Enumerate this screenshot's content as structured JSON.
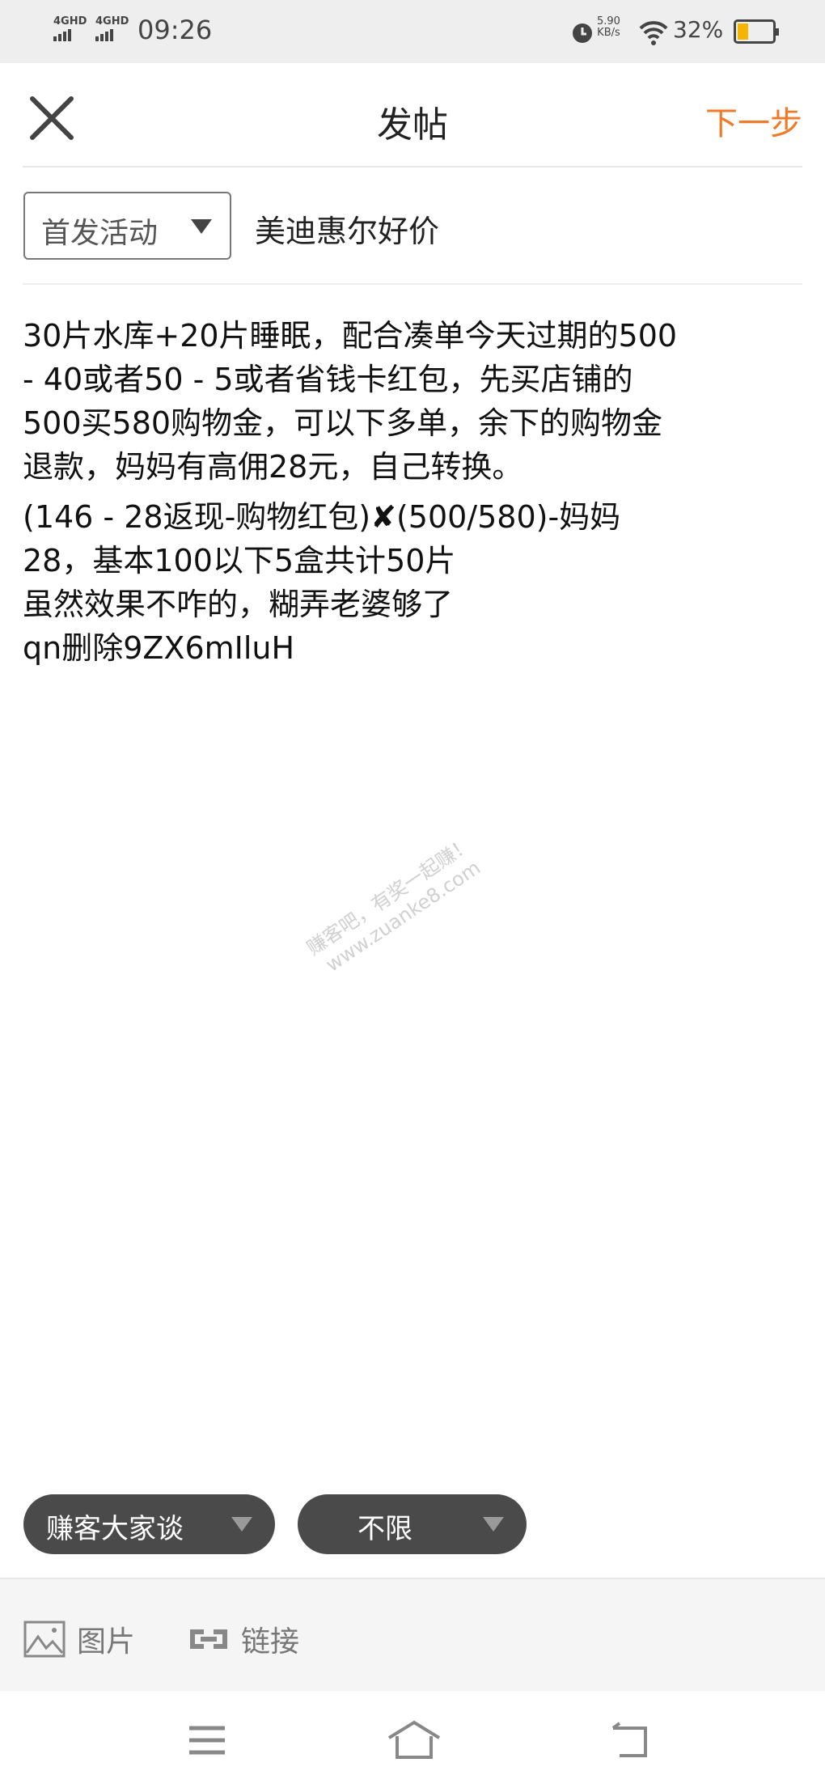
{
  "status_bar": {
    "network1": "4GHD",
    "network2": "4GHD",
    "time": "09:26",
    "speed_value": "5.90",
    "speed_unit": "KB/s",
    "battery": "32%",
    "battery_level": 0.32,
    "battery_color": "#f4b400",
    "icons": [
      "alarm-icon",
      "wifi-icon",
      "battery-icon"
    ]
  },
  "header": {
    "title": "发帖",
    "next_label": "下一步",
    "close_icon": "close-icon",
    "accent": "#f07a28"
  },
  "category_select": {
    "value": "首发活动"
  },
  "subject": "美迪惠尔好价",
  "body_lines": [
    "30片水库+20片睡眠，配合凑单今天过期的500",
    " - 40或者50 - 5或者省钱卡红包，先买店铺的",
    "500买580购物金，可以下多单，余下的购物金",
    "退款，妈妈有高佣28元，自己转换。",
    "(146 - 28返现-购物红包)✘(500/580)-妈妈",
    "28，基本100以下5盒共计50片",
    "虽然效果不咋的，糊弄老婆够了",
    "qn删除9ZX6mIluH"
  ],
  "watermark": {
    "line1": "赚客吧，有奖一起赚！",
    "line2": "www.zuanke8.com"
  },
  "pills": [
    {
      "label": "赚客大家谈"
    },
    {
      "label": "不限"
    }
  ],
  "toolbar": {
    "image_label": "图片",
    "link_label": "链接"
  },
  "nav": {
    "icons": [
      "menu-icon",
      "home-icon",
      "back-icon"
    ]
  }
}
